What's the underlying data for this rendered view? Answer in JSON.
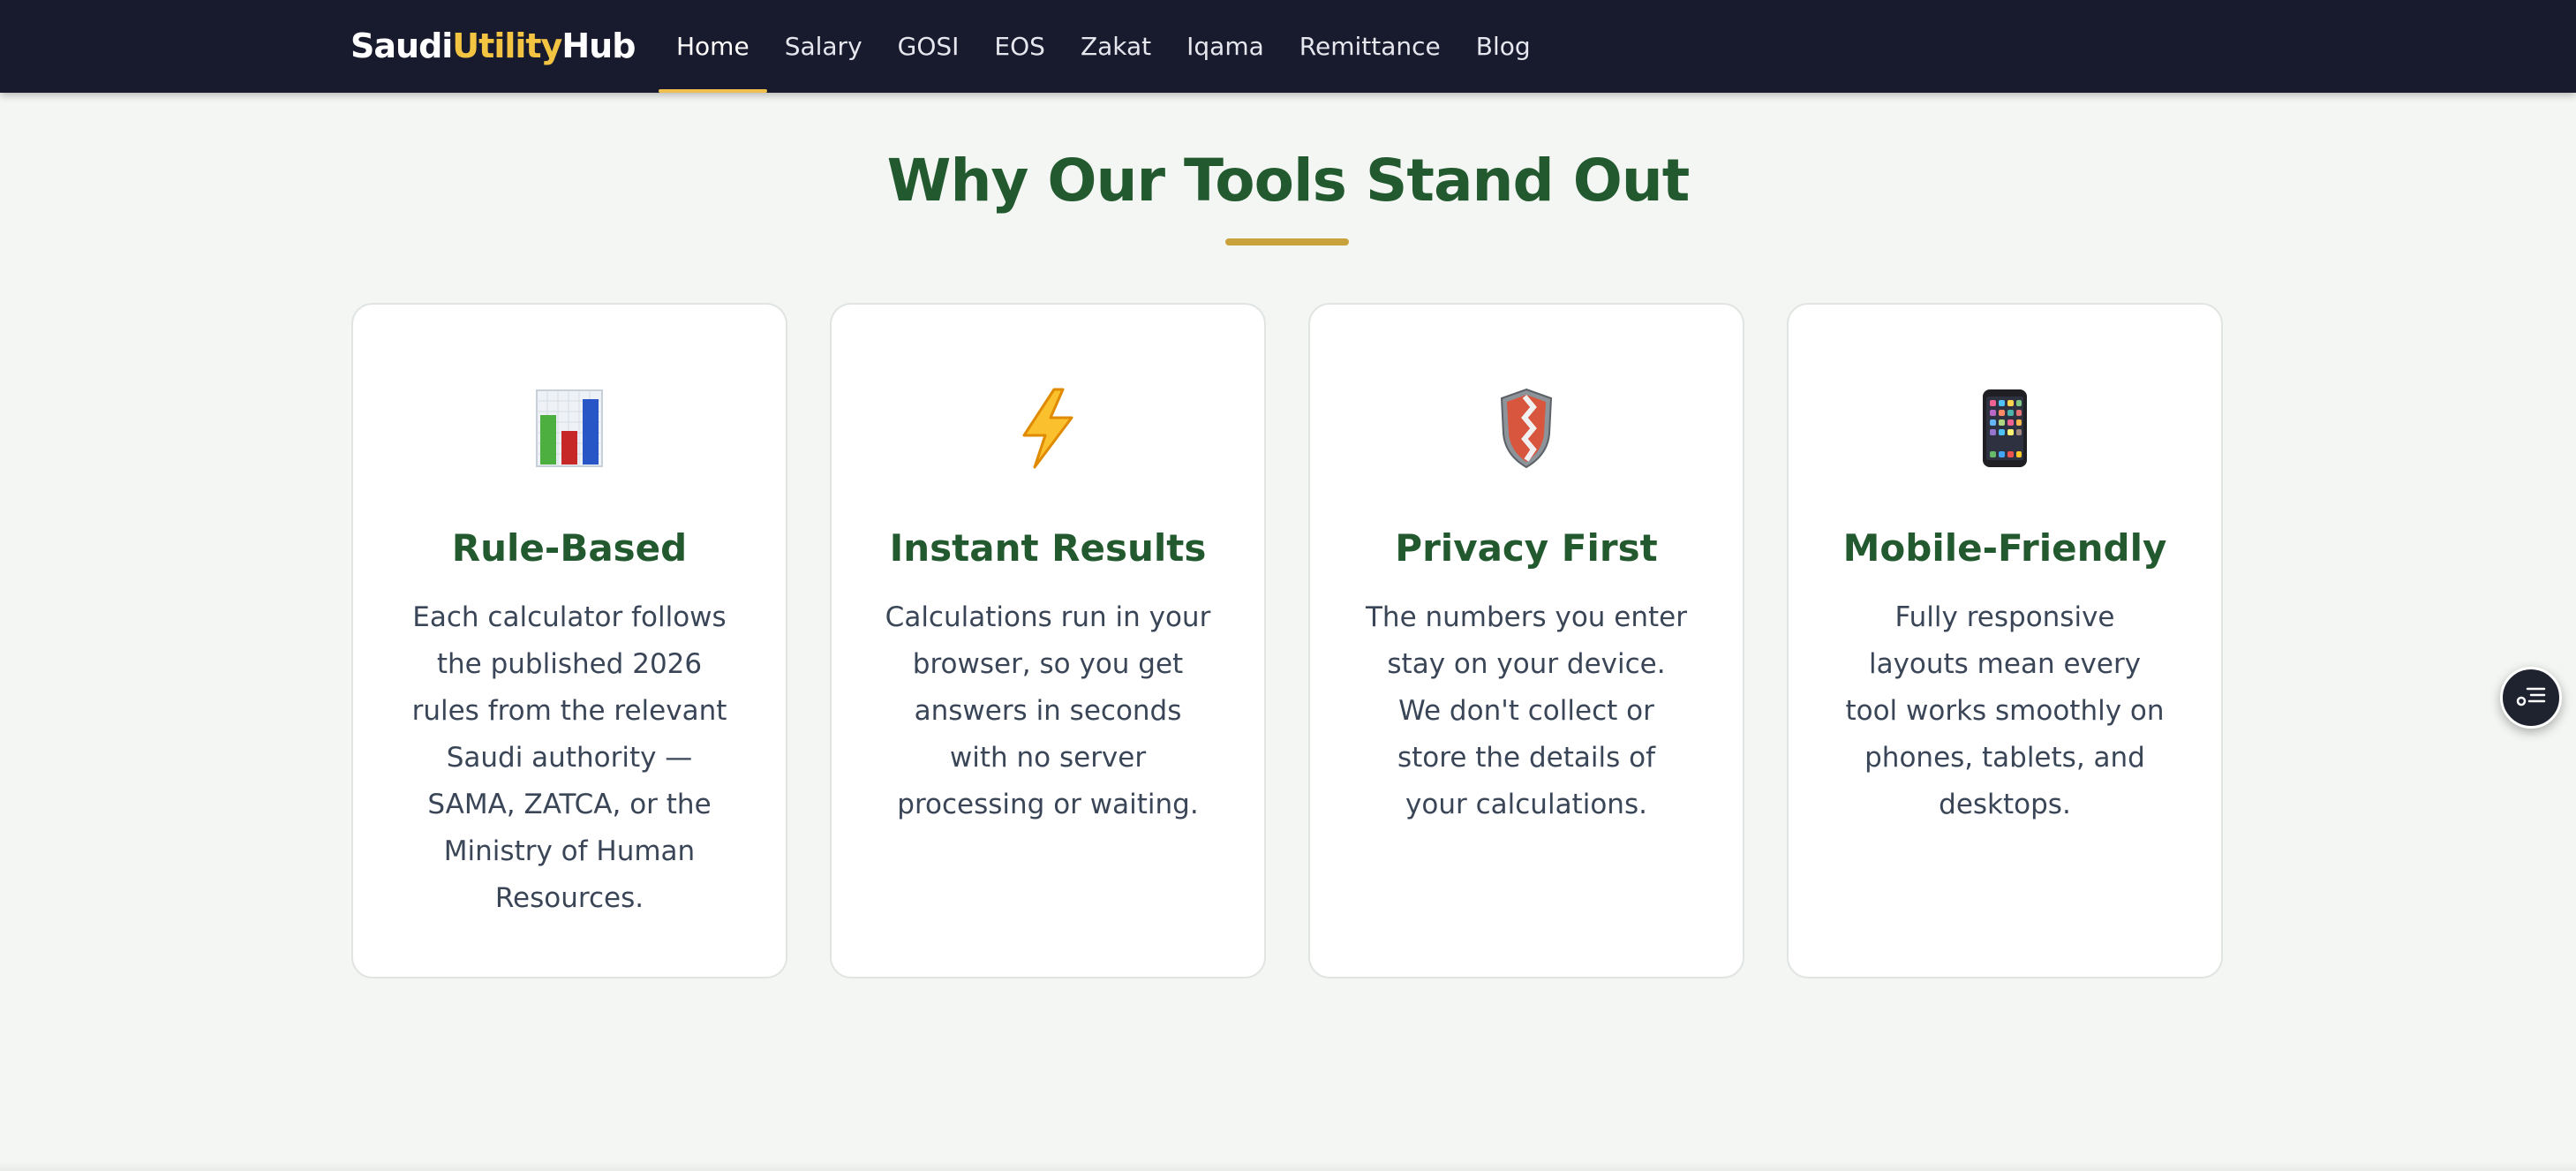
{
  "navbar": {
    "logo": {
      "part1": "Saudi",
      "part2": "Utility",
      "part3": "Hub"
    },
    "links": [
      {
        "label": "Home",
        "active": true
      },
      {
        "label": "Salary"
      },
      {
        "label": "GOSI"
      },
      {
        "label": "EOS"
      },
      {
        "label": "Zakat"
      },
      {
        "label": "Iqama"
      },
      {
        "label": "Remittance"
      },
      {
        "label": "Blog"
      }
    ]
  },
  "section": {
    "title": "Why Our Tools Stand Out",
    "cards": [
      {
        "icon": "bar-chart-icon",
        "title": "Rule-Based",
        "text": "Each calculator follows the published 2026 rules from the relevant Saudi authority — SAMA, ZATCA, or the Ministry of Human Resources."
      },
      {
        "icon": "lightning-icon",
        "title": "Instant Results",
        "text": "Calculations run in your browser, so you get answers in seconds with no server processing or waiting."
      },
      {
        "icon": "shield-icon",
        "title": "Privacy First",
        "text": "The numbers you enter stay on your device. We don't collect or store the details of your calculations."
      },
      {
        "icon": "mobile-phone-icon",
        "title": "Mobile-Friendly",
        "text": "Fully responsive layouts mean every tool works smoothly on phones, tablets, and desktops."
      }
    ]
  },
  "floating_button": {
    "icon": "toc-list-icon"
  },
  "colors": {
    "nav_bg": "#181a2e",
    "accent_gold": "#f3c442",
    "heading_green": "#23592f",
    "page_bg": "#f4f6f3"
  }
}
